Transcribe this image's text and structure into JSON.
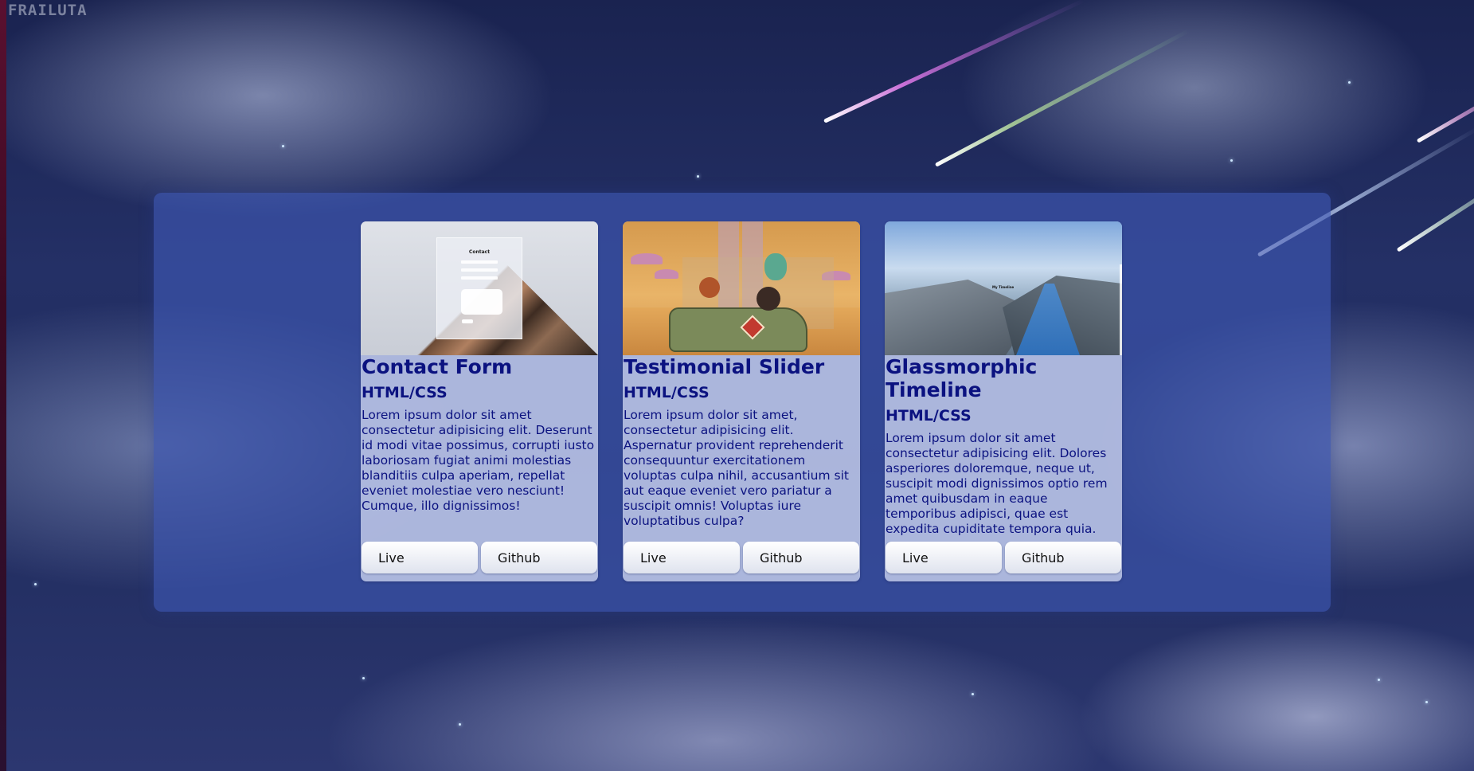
{
  "watermark": "FRAILUTA",
  "projects": [
    {
      "title": "Contact Form",
      "tech": "HTML/CSS",
      "description": "Lorem ipsum dolor sit amet consectetur adipisicing elit. Deserunt id modi vitae possimus, corrupti iusto laboriosam fugiat animi molestias blanditiis culpa aperiam, repellat eveniet molestiae vero nesciunt! Cumque, illo dignissimos!",
      "live_label": "Live",
      "github_label": "Github",
      "thumbnail_title": "Contact"
    },
    {
      "title": "Testimonial Slider",
      "tech": "HTML/CSS",
      "description": "Lorem ipsum dolor sit amet, consectetur adipisicing elit. Aspernatur provident reprehenderit consequuntur exercitationem voluptas culpa nihil, accusantium sit aut eaque eveniet vero pariatur a suscipit omnis! Voluptas iure voluptatibus culpa?",
      "live_label": "Live",
      "github_label": "Github"
    },
    {
      "title": "Glassmorphic Timeline",
      "tech": "HTML/CSS",
      "description": "Lorem ipsum dolor sit amet consectetur adipisicing elit. Dolores asperiores doloremque, neque ut, suscipit modi dignissimos optio rem amet quibusdam in eaque temporibus adipisci, quae est expedita cupiditate tempora quia.",
      "live_label": "Live",
      "github_label": "Github",
      "thumbnail_title": "My Timeline"
    }
  ],
  "colors": {
    "heading_text": "#0b1280",
    "panel": "#3c55af",
    "card": "#cdd5f0"
  }
}
